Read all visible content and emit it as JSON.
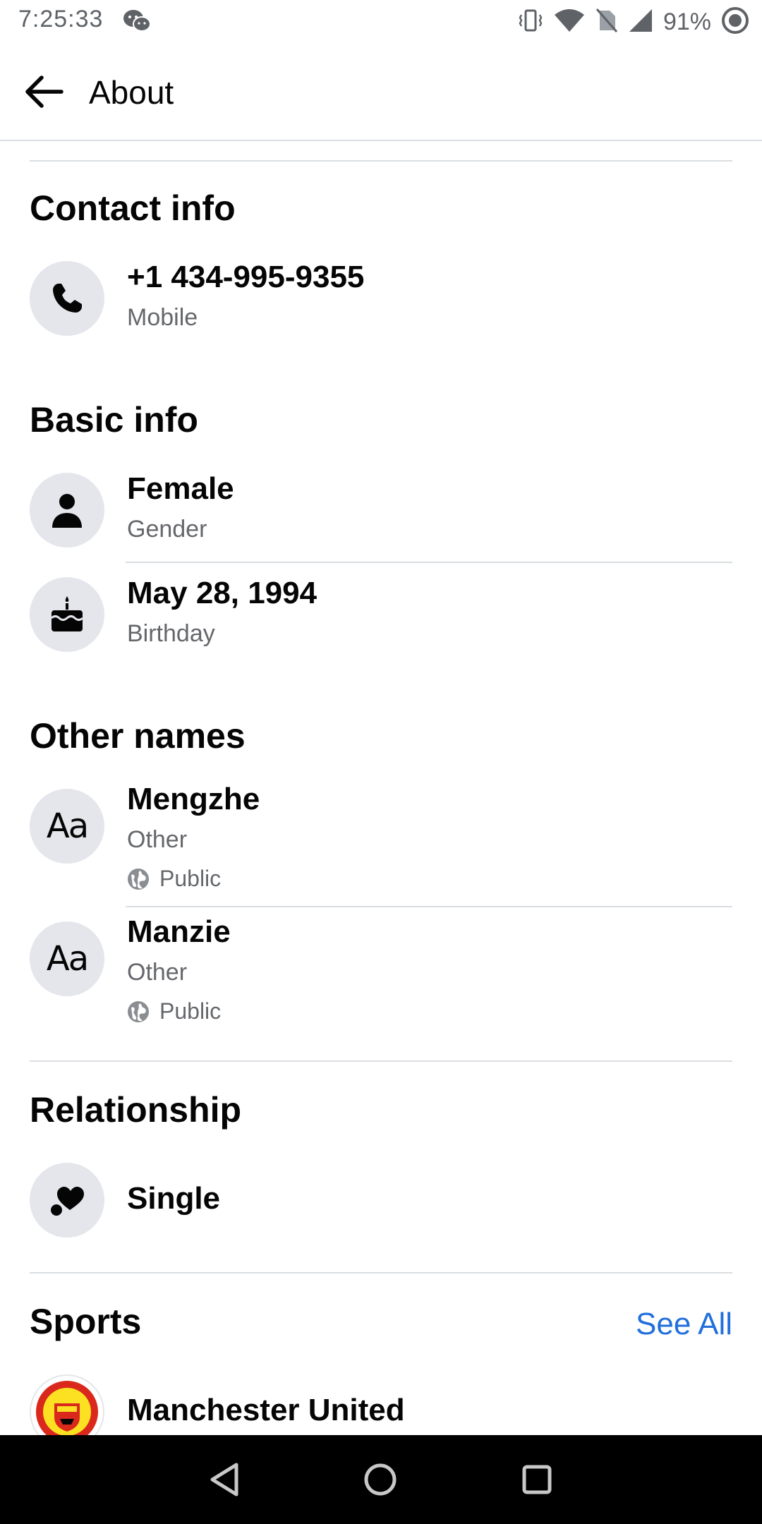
{
  "status_bar": {
    "time": "7:25:33",
    "battery": "91%",
    "icons": [
      "wechat-icon",
      "vibrate-icon",
      "wifi-icon",
      "no-sim-icon",
      "signal-icon",
      "battery-icon"
    ]
  },
  "app_bar": {
    "back_icon": "arrow-left-icon",
    "title": "About"
  },
  "contact_info": {
    "title": "Contact info",
    "phone": {
      "value": "+1 434-995-9355",
      "label": "Mobile",
      "icon": "phone-icon"
    }
  },
  "basic_info": {
    "title": "Basic info",
    "items": [
      {
        "value": "Female",
        "label": "Gender",
        "icon": "person-icon"
      },
      {
        "value": "May 28, 1994",
        "label": "Birthday",
        "icon": "cake-icon"
      }
    ]
  },
  "other_names": {
    "title": "Other names",
    "items": [
      {
        "value": "Mengzhe",
        "label": "Other",
        "privacy": "Public",
        "icon": "text-aa-icon",
        "icon_text": "Aa"
      },
      {
        "value": "Manzie",
        "label": "Other",
        "privacy": "Public",
        "icon": "text-aa-icon",
        "icon_text": "Aa"
      }
    ]
  },
  "relationship": {
    "title": "Relationship",
    "value": "Single",
    "icon": "heart-icon"
  },
  "sports": {
    "title": "Sports",
    "see_all": "See All",
    "items": [
      {
        "value": "Manchester United",
        "icon": "team-logo"
      }
    ]
  },
  "nav_bar": {
    "icons": [
      "nav-back-icon",
      "nav-home-icon",
      "nav-recents-icon"
    ]
  },
  "colors": {
    "link": "#216fdb",
    "secondary_text": "#65676b",
    "icon_bg": "#e4e6eb",
    "divider": "#dadde1"
  }
}
